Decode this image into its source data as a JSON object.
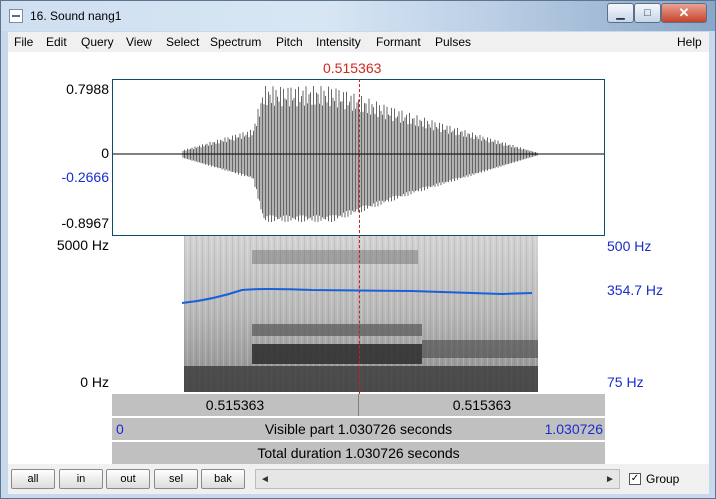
{
  "window": {
    "title": "16. Sound nang1"
  },
  "window_buttons": {
    "minimize": "▁",
    "maximize": "□",
    "close": "✕"
  },
  "menu": {
    "items": [
      "File",
      "Edit",
      "Query",
      "View",
      "Select",
      "Spectrum",
      "Pitch",
      "Intensity",
      "Formant",
      "Pulses"
    ],
    "help": "Help"
  },
  "cursor": {
    "time": "0.515363"
  },
  "waveform": {
    "y_max": "0.7988",
    "y_zero": "0",
    "y_cursor_value": "-0.2666",
    "y_min": "-0.8967"
  },
  "spectrogram": {
    "freq_max": "5000 Hz",
    "freq_min": "0 Hz",
    "pitch_max": "500 Hz",
    "pitch_current": "354.7 Hz",
    "pitch_min": "75 Hz"
  },
  "time_bar": {
    "left": "0.515363",
    "right": "0.515363"
  },
  "visible_bar": {
    "start": "0",
    "label": "Visible part 1.030726 seconds",
    "end": "1.030726"
  },
  "total_bar": {
    "label": "Total duration 1.030726 seconds"
  },
  "toolbar": {
    "buttons": [
      "all",
      "in",
      "out",
      "sel",
      "bak"
    ],
    "group_label": "Group",
    "group_checked": true,
    "scroll_left": "◄",
    "scroll_right": "►",
    "check_mark": "✓"
  },
  "colors": {
    "cursor": "#d0281c",
    "pitch_line": "#1a5fdc",
    "axis_blue": "#1a2ccc"
  }
}
